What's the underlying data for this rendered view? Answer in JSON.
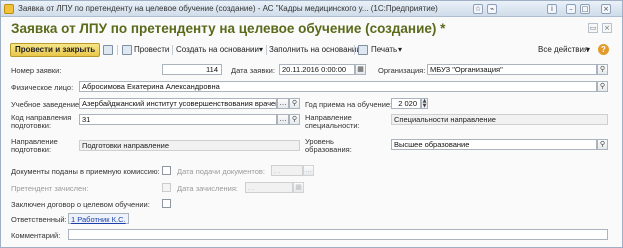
{
  "window": {
    "title": "Заявка от ЛПУ по претенденту на целевое обучение (создание) - АС \"Кадры медицинского у... (1С:Предприятие)"
  },
  "form": {
    "title": "Заявка от ЛПУ по претенденту на целевое обучение (создание) *"
  },
  "toolbar": {
    "post_close": "Провести и закрыть",
    "post": "Провести",
    "create_based": "Создать на основании",
    "fill_based": "Заполнить на основании",
    "print": "Печать",
    "all_actions": "Все действия"
  },
  "fields": {
    "number_label": "Номер заявки:",
    "number_value": "114",
    "date_label": "Дата заявки:",
    "date_value": "20.11.2016  0:00:00",
    "org_label": "Организация:",
    "org_value": "МБУЗ \"Организация\"",
    "person_label": "Физическое лицо:",
    "person_value": "Абросимова Екатерина Александровна",
    "school_label": "Учебное заведение:",
    "school_value": "Азербайджанский институт усовершенствования врачей",
    "year_label": "Год приема на обучение:",
    "year_value": "2 020",
    "code_label_1": "Код направления",
    "code_label_2": "подготовки:",
    "code_value": "31",
    "spec_label_1": "Направление",
    "spec_label_2": "специальности:",
    "spec_value": "Специальности направление",
    "dir_label_1": "Направление",
    "dir_label_2": "подготовки:",
    "dir_value": "Подготовки направление",
    "edu_label_1": "Уровень",
    "edu_label_2": "образования:",
    "edu_value": "Высшее образование",
    "docs_label": "Документы поданы в приемную комиссию:",
    "docs_date_label": "Дата подачи документов:",
    "docs_date_value": ".  .",
    "enrolled_label": "Претендент зачислен:",
    "enroll_date_label": "Дата зачисления:",
    "enroll_date_value": ".  .",
    "contract_label": "Заключен договор о целевом обучении:",
    "responsible_label": "Ответственный:",
    "responsible_value": "1 Работник К.С.",
    "comment_label": "Комментарий:",
    "comment_value": ""
  },
  "icons": {
    "search": "search-icon",
    "dots": "ellipsis-icon",
    "dropdown": "chevron-down-icon",
    "help": "help-icon"
  }
}
